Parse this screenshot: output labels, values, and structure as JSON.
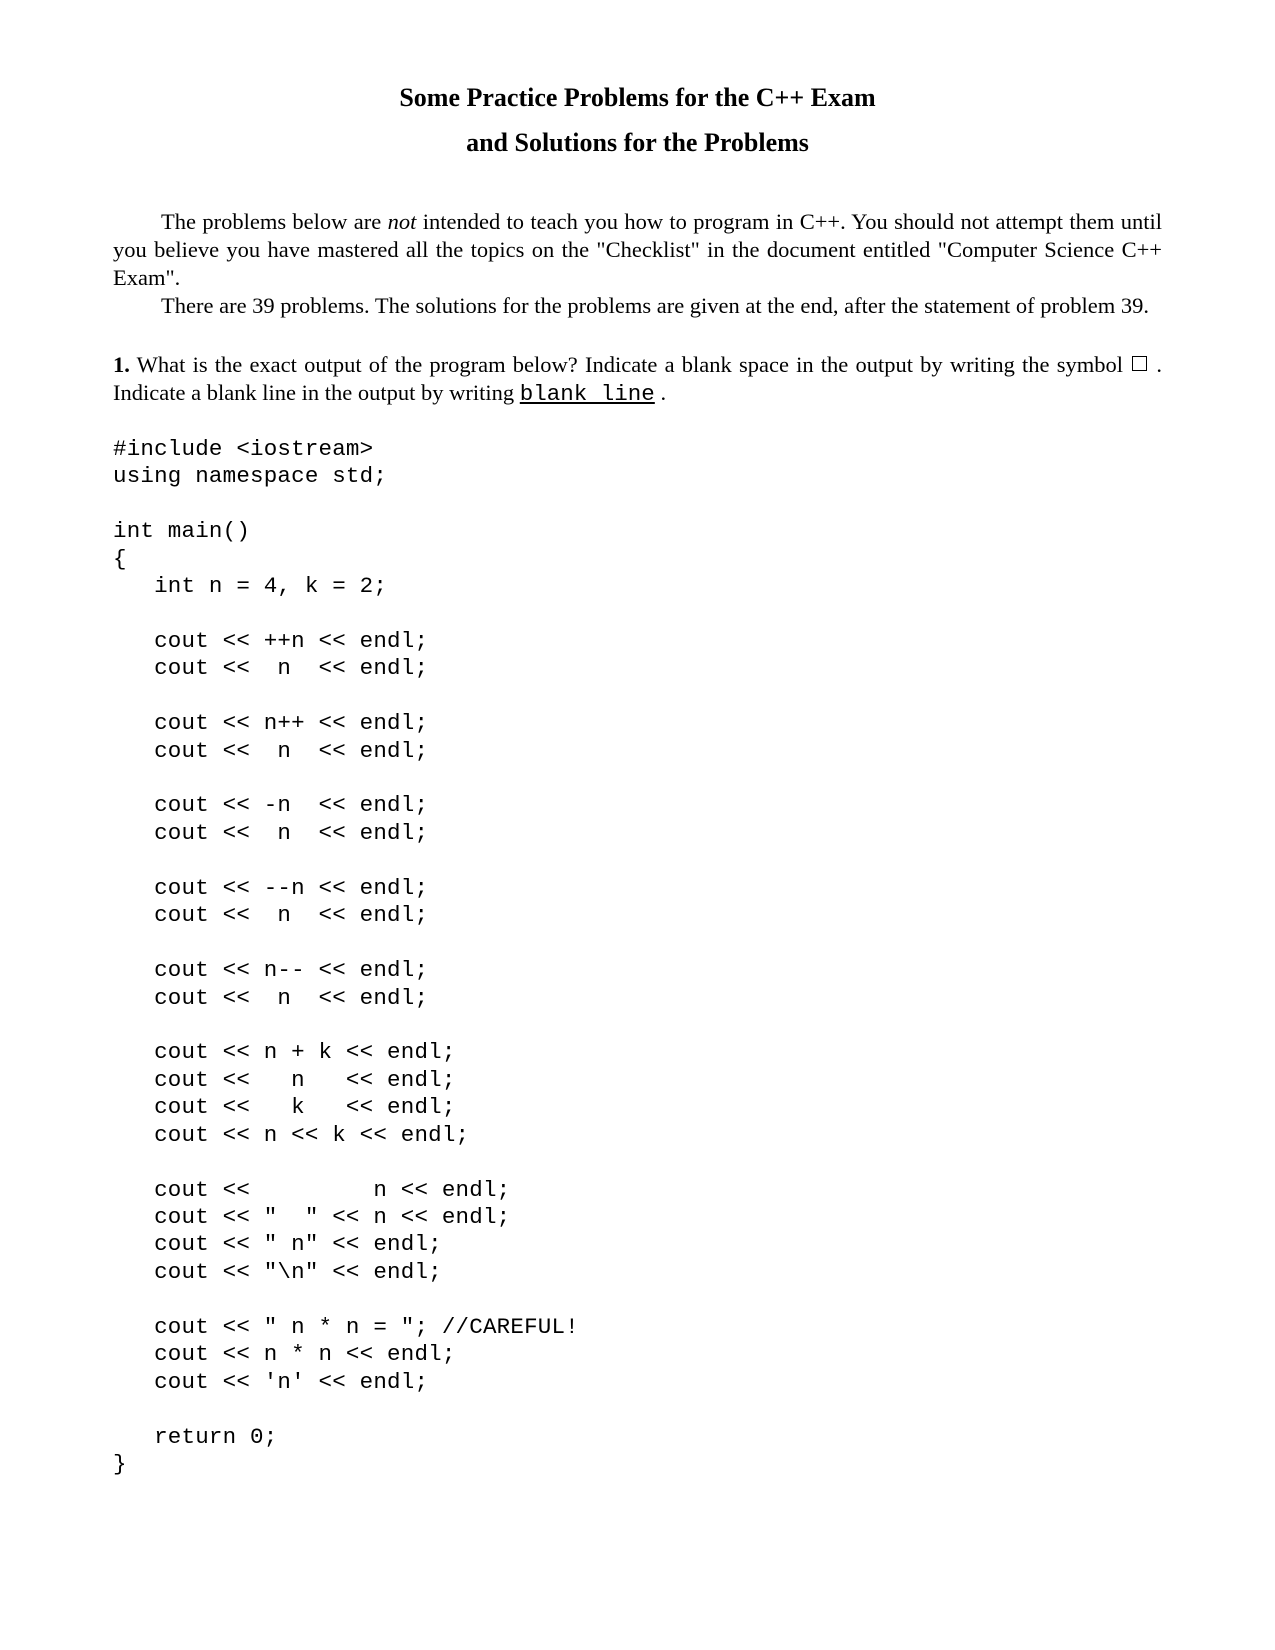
{
  "title": "Some Practice Problems for the C++ Exam",
  "subtitle": "and Solutions for the Problems",
  "para1_a": "The problems below are ",
  "para1_not": "not",
  "para1_b": " intended to teach you how to program in C++.  You should not attempt them until you believe you have mastered all the topics on the \"Checklist\" in the document entitled \"Computer Science C++ Exam\".",
  "para2": "There are 39 problems.  The solutions for the problems are given at the end, after the statement of problem 39.",
  "q1_num": "1.",
  "q1_a": "  What is the exact output of the program below?  Indicate a blank space in the output by writing the symbol ",
  "q1_b": " .  Indicate a blank line in the output by writing  ",
  "q1_blank_line": "blank line",
  "q1_c": " .",
  "code": "#include <iostream>\nusing namespace std;\n\nint main()\n{\n   int n = 4, k = 2;\n\n   cout << ++n << endl;\n   cout <<  n  << endl;\n\n   cout << n++ << endl;\n   cout <<  n  << endl;\n\n   cout << -n  << endl;\n   cout <<  n  << endl;\n\n   cout << --n << endl;\n   cout <<  n  << endl;\n\n   cout << n-- << endl;\n   cout <<  n  << endl;\n\n   cout << n + k << endl;\n   cout <<   n   << endl;\n   cout <<   k   << endl;\n   cout << n << k << endl;\n\n   cout <<         n << endl;\n   cout << \"  \" << n << endl;\n   cout << \" n\" << endl;\n   cout << \"\\n\" << endl;\n\n   cout << \" n * n = \"; //CAREFUL!\n   cout << n * n << endl;\n   cout << 'n' << endl;\n\n   return 0;\n}"
}
